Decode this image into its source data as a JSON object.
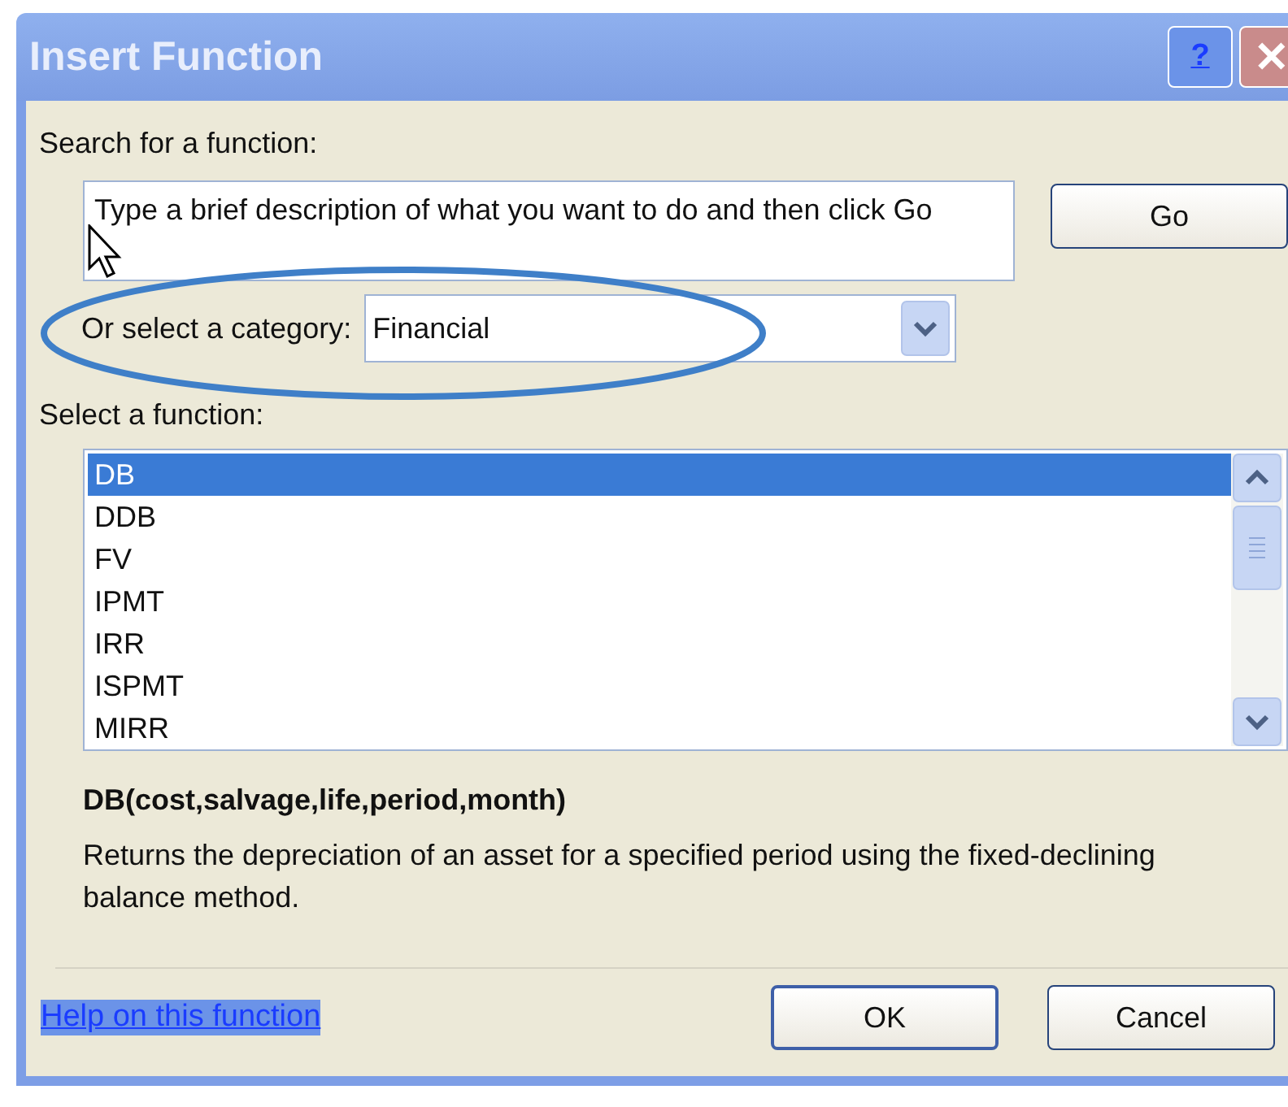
{
  "window": {
    "title": "Insert Function",
    "help_button": "?",
    "close_button": "✕"
  },
  "search": {
    "label": "Search for a function:",
    "value": "Type a brief description of what you want to do and then click Go",
    "button": "Go"
  },
  "category": {
    "label": "Or select a category:",
    "value": "Financial",
    "highlighted": true
  },
  "functions": {
    "label": "Select a function:",
    "items": [
      {
        "name": "DB",
        "selected": true
      },
      {
        "name": "DDB",
        "selected": false
      },
      {
        "name": "FV",
        "selected": false
      },
      {
        "name": "IPMT",
        "selected": false
      },
      {
        "name": "IRR",
        "selected": false
      },
      {
        "name": "ISPMT",
        "selected": false
      },
      {
        "name": "MIRR",
        "selected": false
      }
    ]
  },
  "signature": "DB(cost,salvage,life,period,month)",
  "description": "Returns the depreciation of an asset for a specified period using the fixed-declining balance method.",
  "help_link": "Help on this function",
  "buttons": [
    "OK",
    "Cancel"
  ]
}
